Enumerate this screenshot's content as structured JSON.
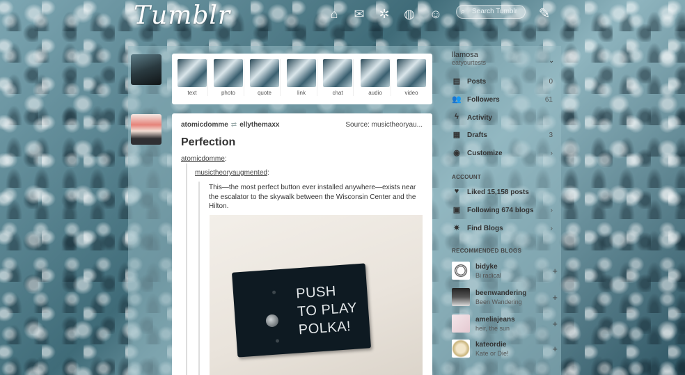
{
  "topbar": {
    "logo": "Tumblr",
    "search_placeholder": "Search Tumblr"
  },
  "post_types": [
    {
      "label": "text"
    },
    {
      "label": "photo"
    },
    {
      "label": "quote"
    },
    {
      "label": "link"
    },
    {
      "label": "chat"
    },
    {
      "label": "audio"
    },
    {
      "label": "video"
    }
  ],
  "post": {
    "author": "atomicdomme",
    "reblogged_from": "ellythemaxx",
    "source": "Source: musictheoryau...",
    "title": "Perfection",
    "quote_user": "atomicdomme",
    "quote_user2": "musictheoryaugmented",
    "quote_text": "This—the most perfect button ever installed anywhere—exists near the escalator to the skywalk between the Wisconsin Center and the Hilton.",
    "plate_text_1": "PUSH",
    "plate_text_2": "TO PLAY",
    "plate_text_3": "POLKA!"
  },
  "sidebar": {
    "account_name": "llamosa",
    "account_sub": "eatyourtests",
    "items": [
      {
        "label": "Posts",
        "count": "0",
        "icon": "posts-icon"
      },
      {
        "label": "Followers",
        "count": "61",
        "icon": "followers-icon"
      },
      {
        "label": "Activity",
        "count": "",
        "icon": "activity-icon"
      },
      {
        "label": "Drafts",
        "count": "3",
        "icon": "drafts-icon"
      },
      {
        "label": "Customize",
        "count": "",
        "icon": "customize-icon"
      }
    ],
    "account_header": "ACCOUNT",
    "account_items": [
      {
        "label": "Liked 15,158 posts",
        "icon": "heart-icon"
      },
      {
        "label": "Following 674 blogs",
        "icon": "following-icon"
      },
      {
        "label": "Find Blogs",
        "icon": "find-blogs-icon"
      }
    ],
    "recommended_header": "RECOMMENDED BLOGS",
    "recommended": [
      {
        "name": "bidyke",
        "tagline": "Bi radical"
      },
      {
        "name": "beenwandering",
        "tagline": "Been Wandering"
      },
      {
        "name": "ameliajeans",
        "tagline": "heir, the sun"
      },
      {
        "name": "kateordie",
        "tagline": "Kate or Die!"
      }
    ]
  }
}
